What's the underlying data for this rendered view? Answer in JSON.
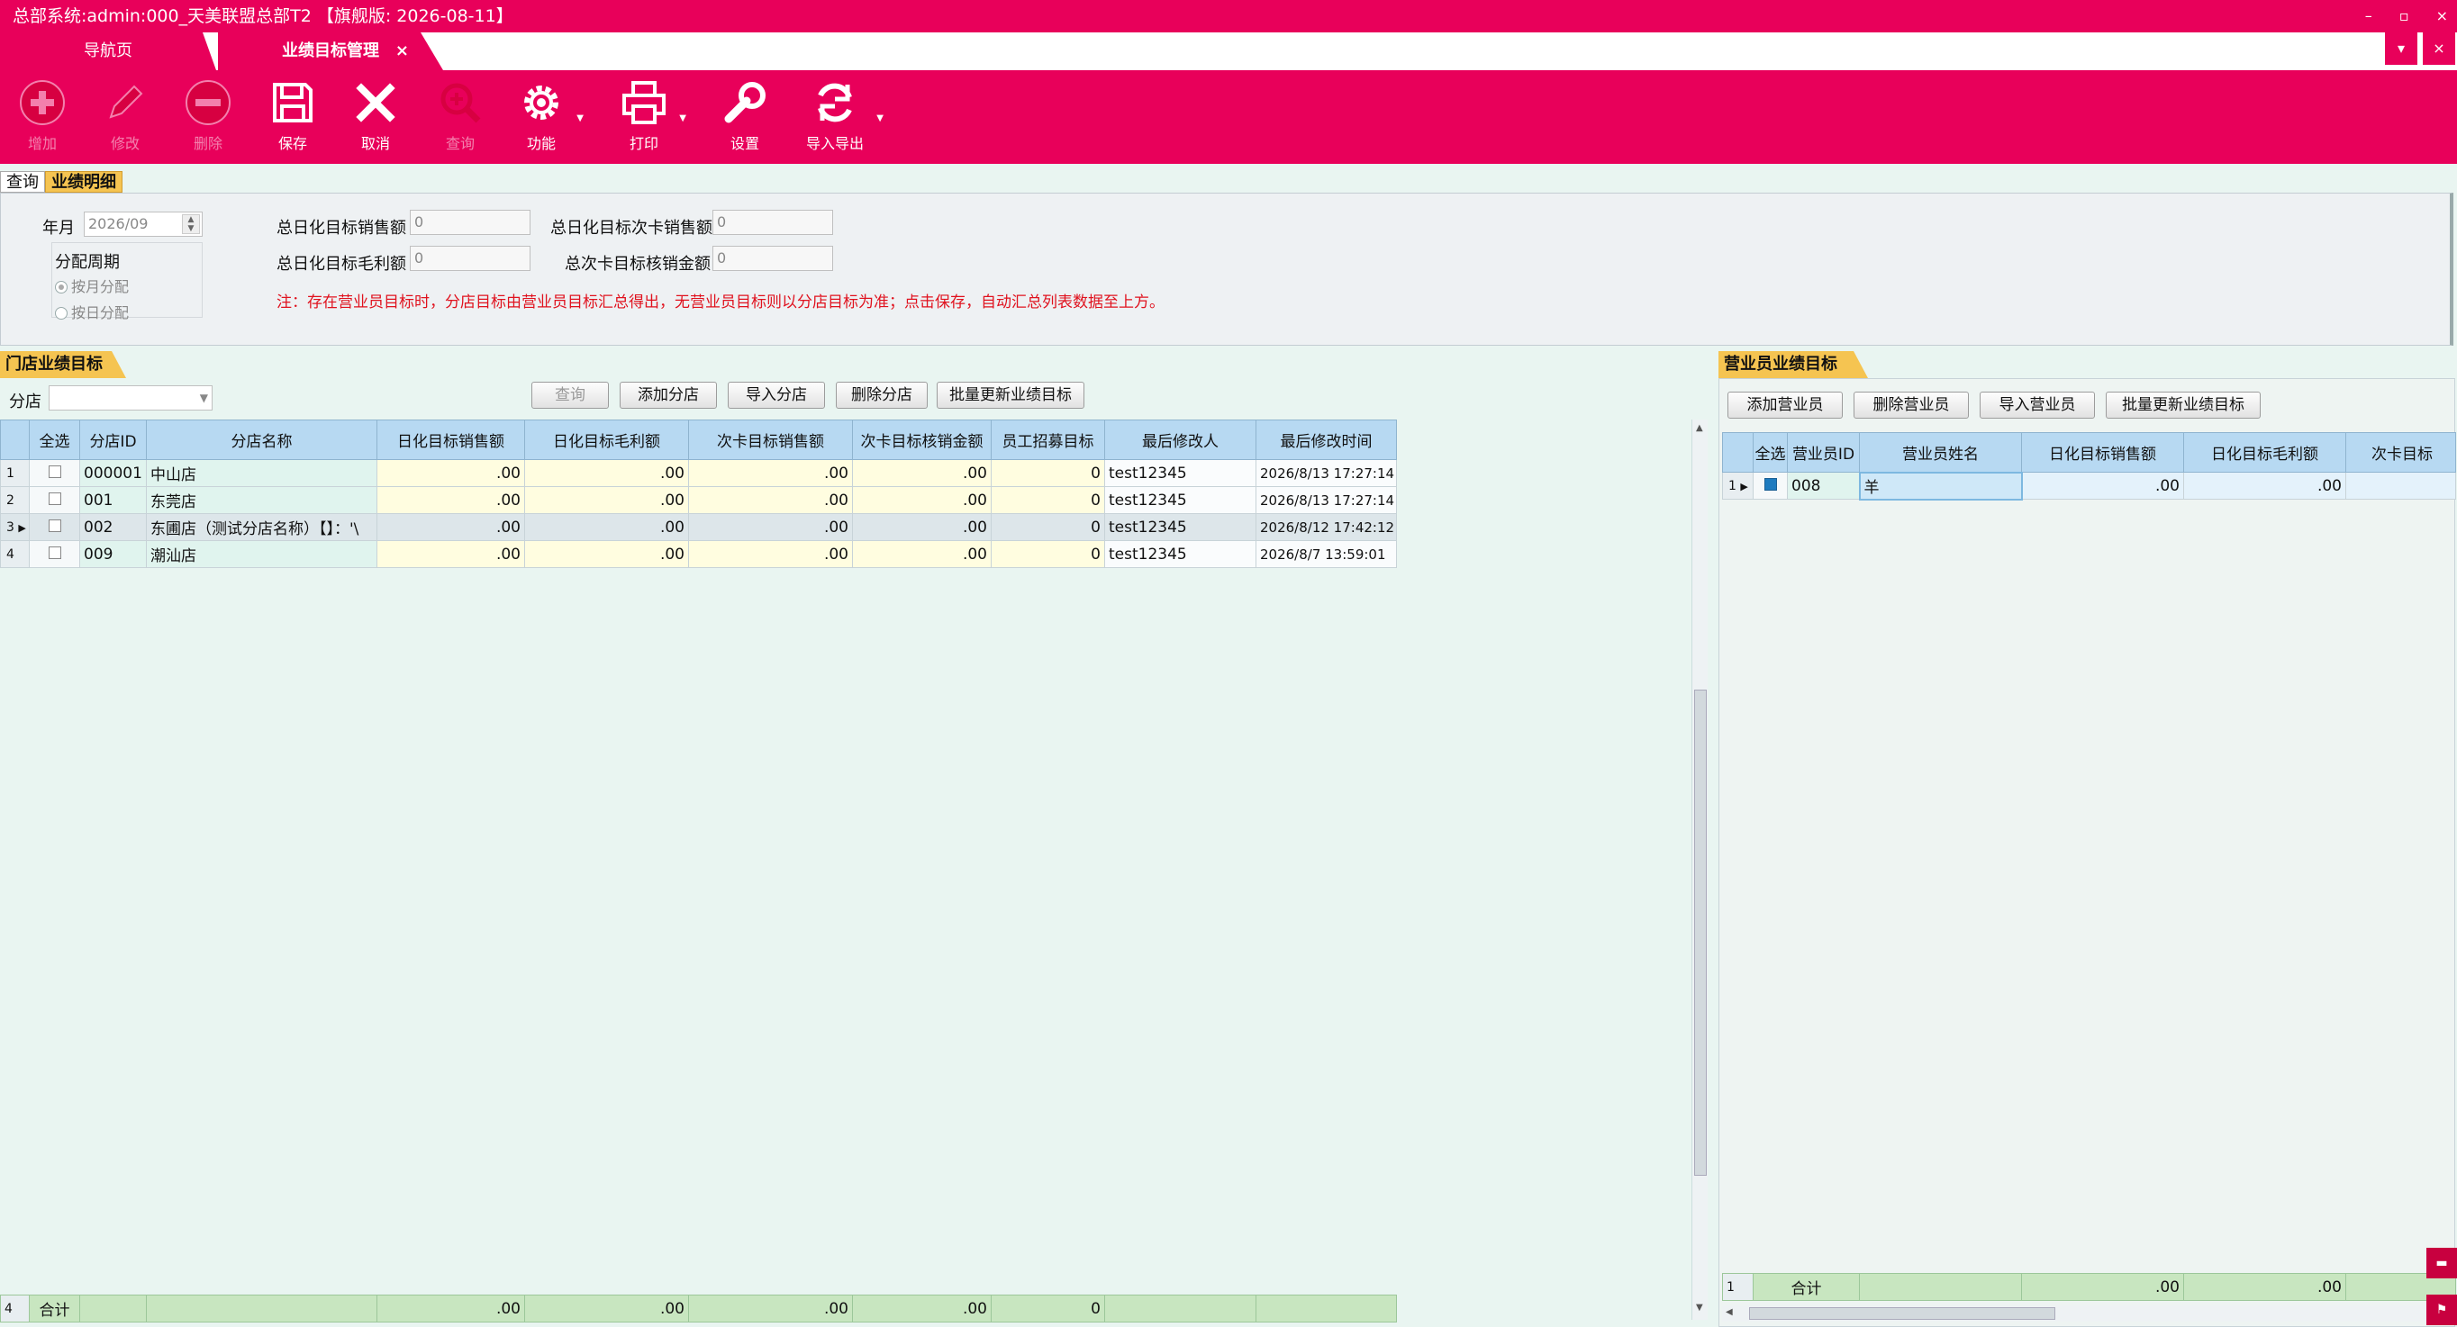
{
  "window": {
    "title": "总部系统:admin:000_天美联盟总部T2 【旗舰版: 2026-08-11】"
  },
  "tabs": {
    "nav": "导航页",
    "current": "业绩目标管理",
    "close": "×",
    "menu": "▾",
    "close_all": "×"
  },
  "toolbar": [
    {
      "icon": "plus-circle-icon",
      "label": "增加",
      "enabled": false
    },
    {
      "icon": "pencil-icon",
      "label": "修改",
      "enabled": false
    },
    {
      "icon": "minus-circle-icon",
      "label": "删除",
      "enabled": false
    },
    {
      "icon": "save-disk-icon",
      "label": "保存",
      "enabled": true
    },
    {
      "icon": "cancel-x-icon",
      "label": "取消",
      "enabled": true
    },
    {
      "icon": "magnifier-icon",
      "label": "查询",
      "enabled": false
    },
    {
      "icon": "gear-icon",
      "label": "功能",
      "enabled": true
    },
    {
      "icon": "printer-icon",
      "label": "打印",
      "enabled": true
    },
    {
      "icon": "wrench-icon",
      "label": "设置",
      "enabled": true
    },
    {
      "icon": "refresh-icon",
      "label": "导入导出",
      "enabled": true
    }
  ],
  "section_tabs": {
    "query": "查询",
    "detail": "业绩明细"
  },
  "form": {
    "year_month_label": "年月",
    "year_month_value": "2026/09",
    "period_label": "分配周期",
    "period_monthly": "按月分配",
    "period_daily": "按日分配",
    "total_sales_label": "总日化目标销售额",
    "total_sales_value": "0",
    "total_margin_label": "总日化目标毛利额",
    "total_margin_value": "0",
    "total_card_sales_label": "总日化目标次卡销售额",
    "total_card_sales_value": "0",
    "total_card_verify_label": "总次卡目标核销金额",
    "total_card_verify_value": "0",
    "note": "注：存在营业员目标时，分店目标由营业员目标汇总得出，无营业员目标则以分店目标为准；点击保存，自动汇总列表数据至上方。"
  },
  "store_section": {
    "title": "门店业绩目标",
    "filter_label": "分店",
    "buttons": {
      "query": "查询",
      "add": "添加分店",
      "import": "导入分店",
      "delete": "删除分店",
      "batch": "批量更新业绩目标"
    },
    "columns": [
      "全选",
      "分店ID",
      "分店名称",
      "日化目标销售额",
      "日化目标毛利额",
      "次卡目标销售额",
      "次卡目标核销金额",
      "员工招募目标",
      "最后修改人",
      "最后修改时间"
    ],
    "rows": [
      {
        "n": "1",
        "id": "000001",
        "name": "中山店",
        "sales": ".00",
        "margin": ".00",
        "card_sales": ".00",
        "card_verify": ".00",
        "recruit": "0",
        "modifier": "test12345",
        "time": "2026/8/13 17:27:14"
      },
      {
        "n": "2",
        "id": "001",
        "name": "东莞店",
        "sales": ".00",
        "margin": ".00",
        "card_sales": ".00",
        "card_verify": ".00",
        "recruit": "0",
        "modifier": "test12345",
        "time": "2026/8/13 17:27:14"
      },
      {
        "n": "3",
        "id": "002",
        "name": "东圃店（测试分店名称）【】：'\\",
        "sales": ".00",
        "margin": ".00",
        "card_sales": ".00",
        "card_verify": ".00",
        "recruit": "0",
        "modifier": "test12345",
        "time": "2026/8/12 17:42:12"
      },
      {
        "n": "4",
        "id": "009",
        "name": "潮汕店",
        "sales": ".00",
        "margin": ".00",
        "card_sales": ".00",
        "card_verify": ".00",
        "recruit": "0",
        "modifier": "test12345",
        "time": "2026/8/7 13:59:01"
      }
    ],
    "footer": {
      "count": "4",
      "label": "合计",
      "sales": ".00",
      "margin": ".00",
      "card_sales": ".00",
      "card_verify": ".00",
      "recruit": "0"
    }
  },
  "staff_section": {
    "title": "营业员业绩目标",
    "buttons": {
      "add": "添加营业员",
      "delete": "删除营业员",
      "import": "导入营业员",
      "batch": "批量更新业绩目标"
    },
    "columns": [
      "全选",
      "营业员ID",
      "营业员姓名",
      "日化目标销售额",
      "日化目标毛利额",
      "次卡目标"
    ],
    "rows": [
      {
        "n": "1",
        "id": "008",
        "name": "羊",
        "sales": ".00",
        "margin": ".00"
      }
    ],
    "footer": {
      "count": "1",
      "label": "合计",
      "sales": ".00",
      "margin": ".00"
    }
  }
}
